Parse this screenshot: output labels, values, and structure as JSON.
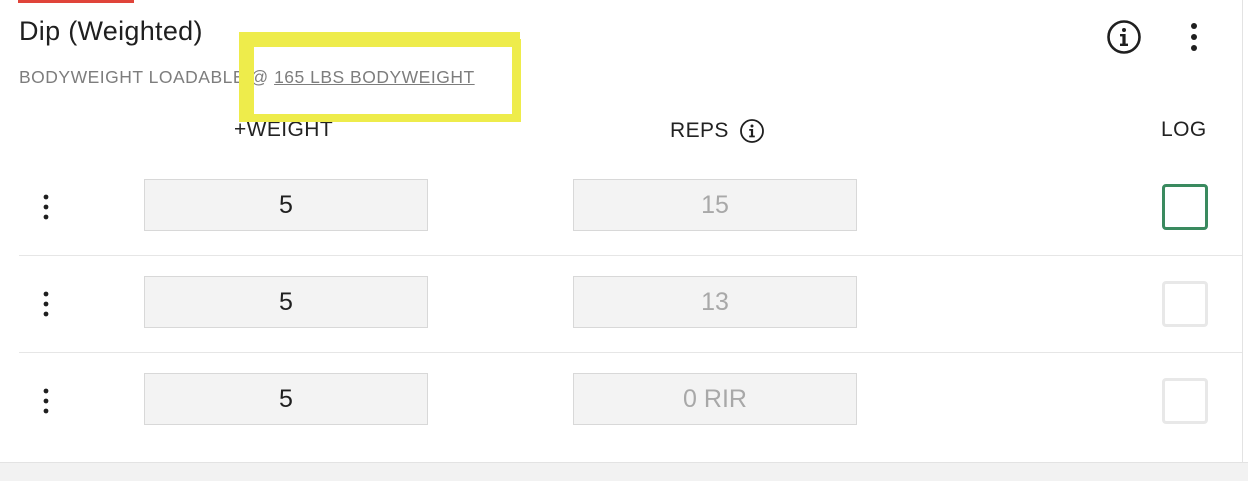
{
  "exercise": {
    "title": "Dip (Weighted)",
    "subtitle_prefix": "BODYWEIGHT LOADABLE",
    "subtitle_at": "@",
    "bodyweight_link": "165 LBS BODYWEIGHT",
    "info_icon": "info-circle-icon",
    "more_icon": "vertical-dots-icon"
  },
  "columns": {
    "weight": "+WEIGHT",
    "reps": "REPS",
    "log": "LOG"
  },
  "sets": [
    {
      "weight": "5",
      "reps_placeholder": "15",
      "logged": false,
      "checkbox_state": "active"
    },
    {
      "weight": "5",
      "reps_placeholder": "13",
      "logged": false,
      "checkbox_state": "inactive"
    },
    {
      "weight": "5",
      "reps_placeholder": "0 RIR",
      "logged": false,
      "checkbox_state": "inactive"
    }
  ],
  "colors": {
    "accent_red": "#e0443a",
    "highlight_yellow": "#eeec4b",
    "checkbox_active_green": "#3a8a5f"
  }
}
